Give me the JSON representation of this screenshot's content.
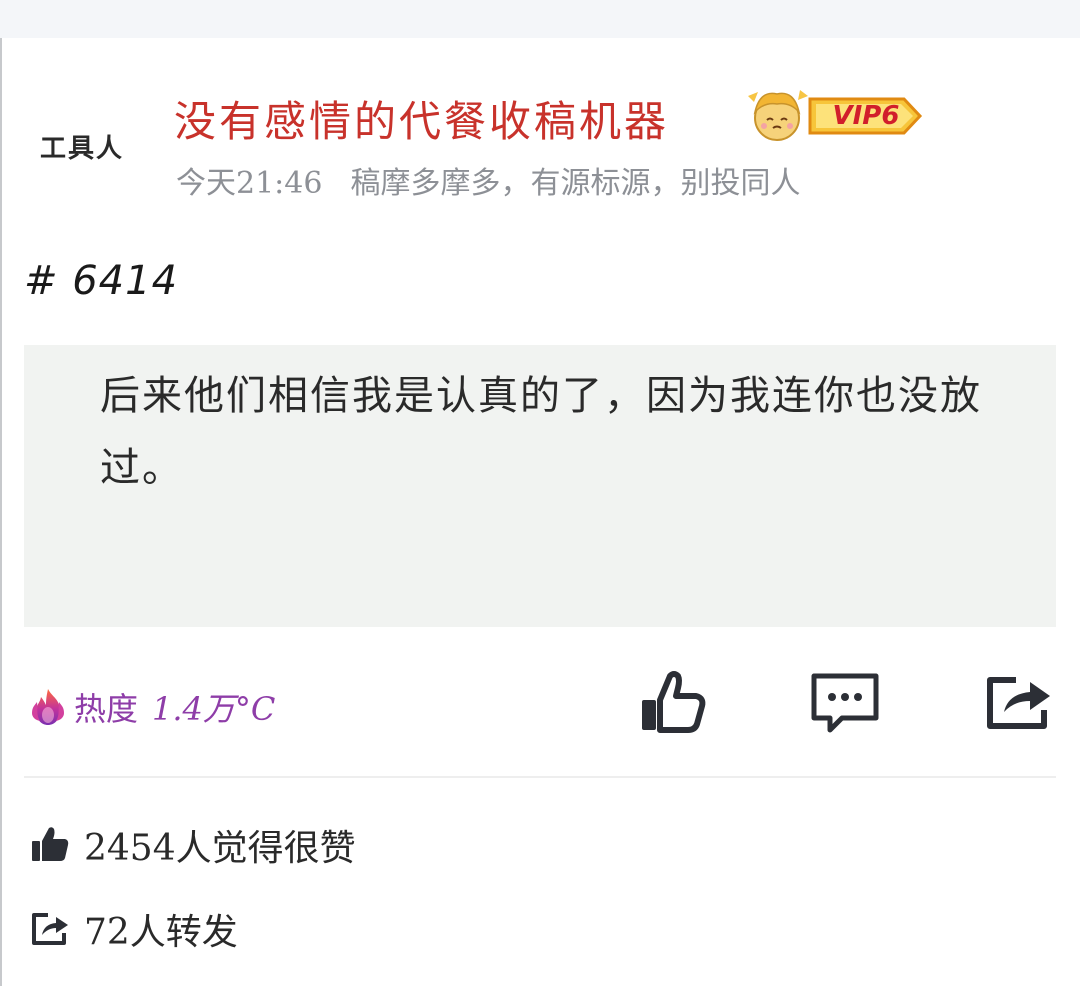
{
  "author": {
    "avatar_text": "工具人",
    "name": "没有感情的代餐收稿机器",
    "vip_label": "VIP6"
  },
  "meta": {
    "time": "今天21:46",
    "bio": "稿摩多摩多，有源标源，别投同人"
  },
  "post": {
    "id": "# 6414",
    "quote": "后来他们相信我是认真的了，因为我连你也没放过。"
  },
  "heat": {
    "label": "热度",
    "value": "1.4万°C",
    "color": "#8e3da8"
  },
  "actions": {
    "like_icon": "thumbs-up-icon",
    "comment_icon": "comment-icon",
    "share_icon": "share-icon"
  },
  "stats": {
    "likes_text": "2454人觉得很赞",
    "reposts_text": "72人转发"
  },
  "colors": {
    "username": "#c8322b",
    "meta": "#8d9096",
    "icon": "#2c2f36",
    "quote_bg": "#f1f3f1"
  }
}
